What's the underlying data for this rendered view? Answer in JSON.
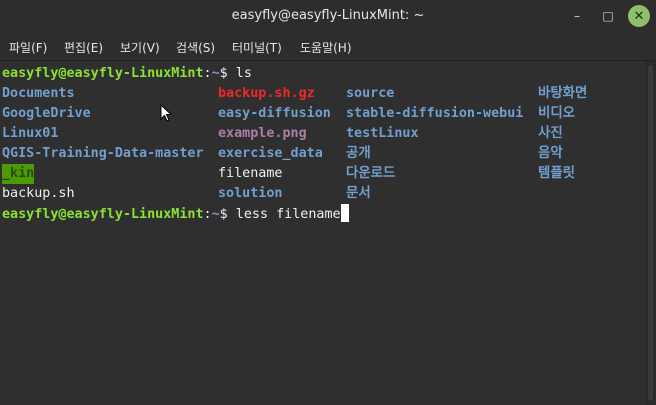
{
  "window": {
    "title": "easyfly@easyfly-LinuxMint: ~"
  },
  "menu": [
    {
      "label": "파일(F)"
    },
    {
      "label": "편집(E)"
    },
    {
      "label": "보기(V)"
    },
    {
      "label": "검색(S)"
    },
    {
      "label": "터미널(T)"
    },
    {
      "label": "도움말(H)"
    }
  ],
  "prompt": {
    "user_host": "easyfly@easyfly-LinuxMint",
    "sep": ":",
    "path": "~",
    "symbol": "$ "
  },
  "commands": {
    "first": "ls",
    "second": "less filename"
  },
  "ls_columns": [
    [
      {
        "text": "Documents",
        "type": "dir"
      },
      {
        "text": "GoogleDrive",
        "type": "dir"
      },
      {
        "text": "Linux01",
        "type": "dir"
      },
      {
        "text": "QGIS-Training-Data-master",
        "type": "dir"
      },
      {
        "text": "_kin",
        "type": "owdir"
      },
      {
        "text": "backup.sh",
        "type": "file"
      }
    ],
    [
      {
        "text": "backup.sh.gz",
        "type": "arch"
      },
      {
        "text": "easy-diffusion",
        "type": "dir"
      },
      {
        "text": "example.png",
        "type": "img"
      },
      {
        "text": "exercise_data",
        "type": "dir"
      },
      {
        "text": "filename",
        "type": "file"
      },
      {
        "text": "solution",
        "type": "dir"
      }
    ],
    [
      {
        "text": "source",
        "type": "dir"
      },
      {
        "text": "stable-diffusion-webui",
        "type": "dir"
      },
      {
        "text": "testLinux",
        "type": "dir"
      },
      {
        "text": "공개",
        "type": "dir"
      },
      {
        "text": "다운로드",
        "type": "dir"
      },
      {
        "text": "문서",
        "type": "dir"
      }
    ],
    [
      {
        "text": "바탕화면",
        "type": "dir"
      },
      {
        "text": "비디오",
        "type": "dir"
      },
      {
        "text": "사진",
        "type": "dir"
      },
      {
        "text": "음악",
        "type": "dir"
      },
      {
        "text": "템플릿",
        "type": "dir"
      }
    ]
  ],
  "colors": {
    "prompt_user": "#8ae234",
    "directory": "#729fcf",
    "archive": "#ef2929",
    "image": "#ad7fa8",
    "other_writable_bg": "#4e9a06",
    "background": "#2f2f2f"
  },
  "icons": {
    "minimize": "minimize-icon",
    "maximize": "maximize-icon",
    "close": "close-icon",
    "pointer": "mouse-pointer-icon"
  }
}
